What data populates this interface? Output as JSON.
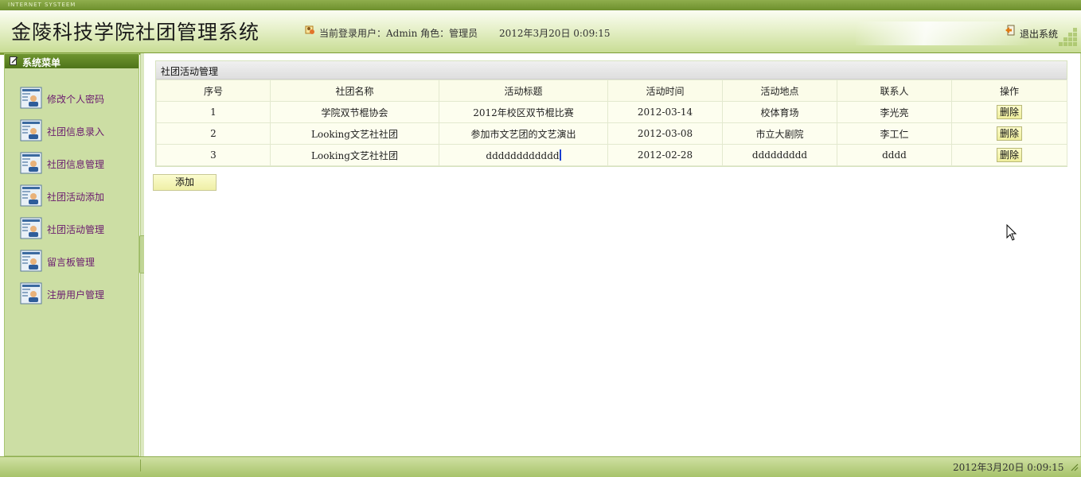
{
  "top_strip": {
    "text": "INTERNET SYSTEEM"
  },
  "header": {
    "title": "金陵科技学院社团管理系统",
    "user_info": "当前登录用户：Admin 角色：管理员",
    "datetime": "2012年3月20日  0:09:15",
    "logout_label": "退出系统"
  },
  "sidebar": {
    "title": "系统菜单",
    "items": [
      {
        "label": "修改个人密码"
      },
      {
        "label": "社团信息录入"
      },
      {
        "label": "社团信息管理"
      },
      {
        "label": "社团活动添加"
      },
      {
        "label": "社团活动管理"
      },
      {
        "label": "留言板管理"
      },
      {
        "label": "注册用户管理"
      }
    ]
  },
  "panel": {
    "title": "社团活动管理",
    "columns": [
      "序号",
      "社团名称",
      "活动标题",
      "活动时间",
      "活动地点",
      "联系人",
      "操作"
    ],
    "rows": [
      {
        "no": "1",
        "club": "学院双节棍协会",
        "title": "2012年校区双节棍比赛",
        "time": "2012-03-14",
        "place": "校体育场",
        "contact": "李光亮",
        "action": "删除"
      },
      {
        "no": "2",
        "club": "Looking文艺社社团",
        "title": "参加市文艺团的文艺演出",
        "time": "2012-03-08",
        "place": "市立大剧院",
        "contact": "李工仁",
        "action": "删除"
      },
      {
        "no": "3",
        "club": "Looking文艺社社团",
        "title": "dddddddddddd",
        "time": "2012-02-28",
        "place": "ddddddddd",
        "contact": "dddd",
        "action": "删除"
      }
    ],
    "add_label": "添加"
  },
  "footer": {
    "datetime": "2012年3月20日  0:09:15"
  },
  "colors": {
    "accent": "#7b9c35",
    "sidebar_bg": "#ccdea4",
    "menu_text": "#6a1a6e"
  },
  "icons": [
    "user-icon",
    "logout-icon",
    "menu-icon",
    "form-user-icon",
    "mouse-cursor-icon"
  ]
}
